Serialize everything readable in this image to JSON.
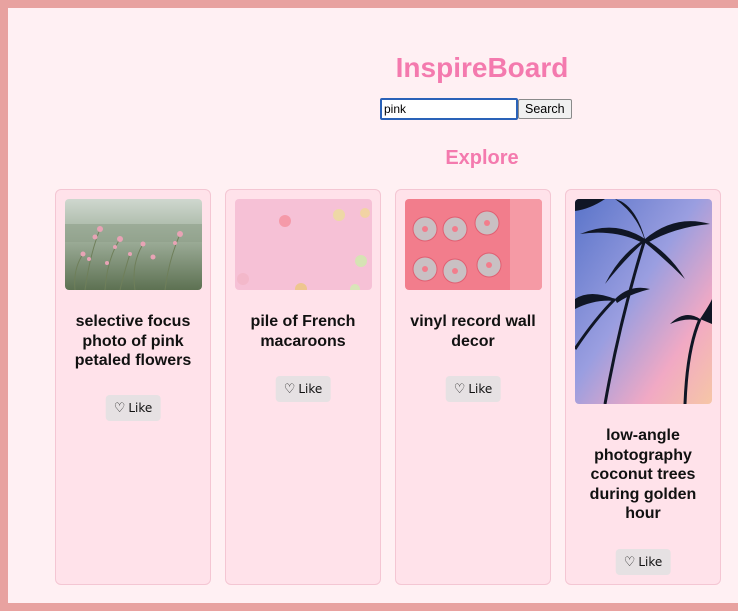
{
  "header": {
    "title": "InspireBoard"
  },
  "search": {
    "value": "pink",
    "button_label": "Search"
  },
  "section": {
    "title": "Explore"
  },
  "cards": [
    {
      "caption": "selective focus photo of pink petaled flowers",
      "like_icon": "heart-outline-icon",
      "like_label": "Like"
    },
    {
      "caption": "pile of French macaroons",
      "like_icon": "heart-outline-icon",
      "like_label": "Like"
    },
    {
      "caption": "vinyl record wall decor",
      "like_icon": "heart-outline-icon",
      "like_label": "Like"
    },
    {
      "caption": "low-angle photography coconut trees during golden hour",
      "like_icon": "heart-outline-icon",
      "like_label": "Like"
    }
  ],
  "colors": {
    "accent": "#f47aae",
    "page_background": "#fff0f3",
    "card_background": "#ffe2ea",
    "frame_border": "#e8a2a0"
  }
}
